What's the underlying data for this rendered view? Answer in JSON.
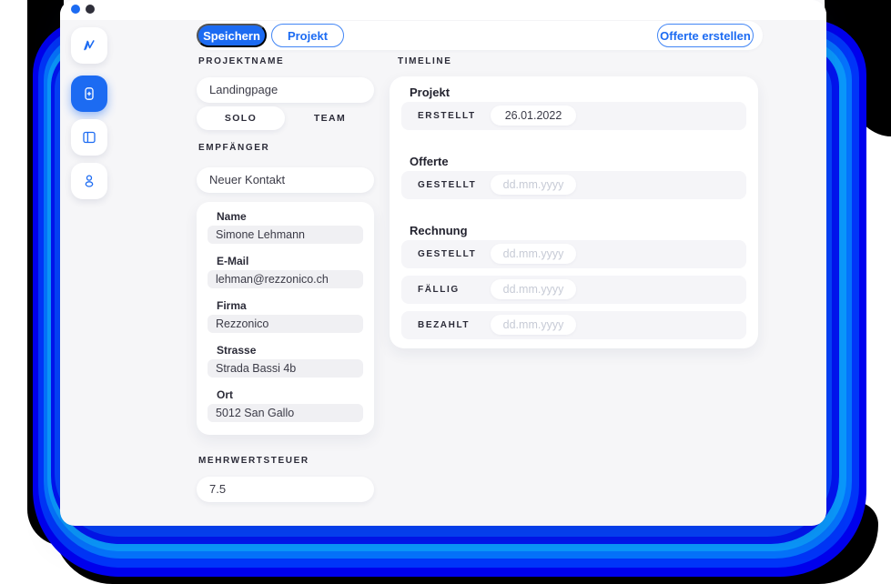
{
  "colors": {
    "primary_blue": "#1c6bf2",
    "glow_blues": [
      "#0001ee",
      "#0136fa",
      "#0575ff",
      "#0a9bff",
      "#0114f5",
      "#0443ff"
    ],
    "window_bg": "#f6f6f8",
    "field_bg": "#f0f0f3",
    "dark_text": "#2b2b38"
  },
  "window": {
    "dots": [
      "blue",
      "dark"
    ]
  },
  "sidebar": {
    "items": [
      {
        "name": "logo",
        "icon": "logo-m-icon",
        "active": false
      },
      {
        "name": "project",
        "icon": "add-project-icon",
        "active": true
      },
      {
        "name": "documents",
        "icon": "split-panel-icon",
        "active": false
      },
      {
        "name": "contacts",
        "icon": "user-icon",
        "active": false
      }
    ]
  },
  "toolbar": {
    "save_label": "Speichern",
    "project_label": "Projekt",
    "create_offer_label": "Offerte erstellen"
  },
  "form": {
    "projektname_label": "PROJEKTNAME",
    "projektname_value": "Landingpage",
    "mode": {
      "options": [
        "SOLO",
        "TEAM"
      ],
      "selected": "SOLO"
    },
    "empfaenger_label": "EMPFÄNGER",
    "empfaenger_value": "Neuer Kontakt",
    "contact_fields": [
      {
        "label": "Name",
        "value": "Simone Lehmann"
      },
      {
        "label": "E-Mail",
        "value": "lehman@rezzonico.ch"
      },
      {
        "label": "Firma",
        "value": "Rezzonico"
      },
      {
        "label": "Strasse",
        "value": "Strada Bassi 4b"
      },
      {
        "label": "Ort",
        "value": "5012 San Gallo"
      }
    ],
    "mwst_label": "MEHRWERTSTEUER",
    "mwst_value": "7.5"
  },
  "timeline": {
    "title": "TIMELINE",
    "sections": [
      {
        "title": "Projekt",
        "rows": [
          {
            "label": "ERSTELLT",
            "value": "26.01.2022",
            "is_placeholder": false
          }
        ]
      },
      {
        "title": "Offerte",
        "rows": [
          {
            "label": "GESTELLT",
            "value": "dd.mm.yyyy",
            "is_placeholder": true
          }
        ]
      },
      {
        "title": "Rechnung",
        "rows": [
          {
            "label": "GESTELLT",
            "value": "dd.mm.yyyy",
            "is_placeholder": true
          },
          {
            "label": "FÄLLIG",
            "value": "dd.mm.yyyy",
            "is_placeholder": true
          },
          {
            "label": "BEZAHLT",
            "value": "dd.mm.yyyy",
            "is_placeholder": true
          }
        ]
      }
    ]
  }
}
